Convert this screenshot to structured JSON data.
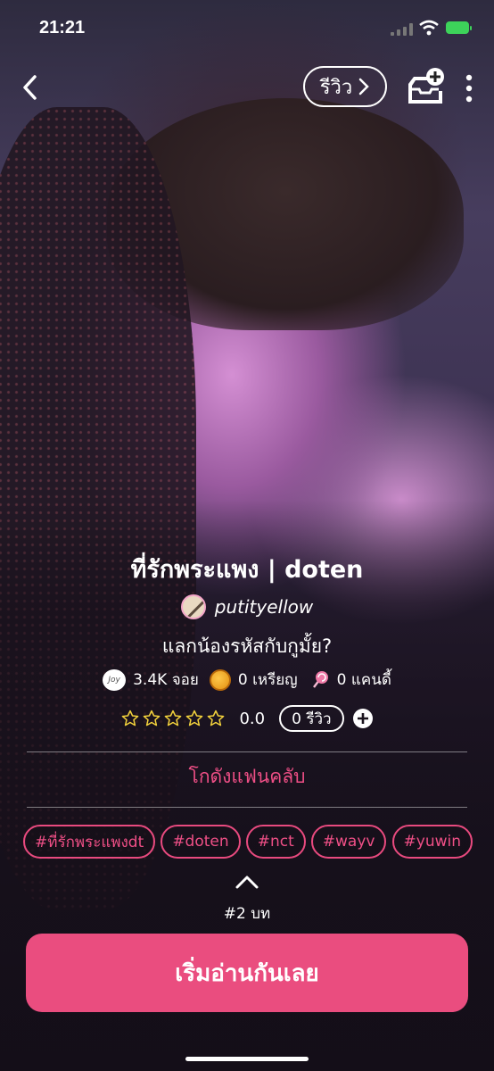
{
  "status_bar": {
    "time": "21:21"
  },
  "header": {
    "review_label": "รีวิว"
  },
  "story": {
    "title": "ที่รักพระแพง | doten",
    "author": "putityellow",
    "tagline": "แลกน้องรหัสกับกูมั้ย?"
  },
  "stats": {
    "joy_badge": "Joy",
    "joy": "3.4K จอย",
    "coins": "0 เหรียญ",
    "candy": "0 แคนดี้"
  },
  "rating": {
    "stars_filled": 0,
    "stars_total": 5,
    "value": "0.0",
    "review_count": "0 รีวิว"
  },
  "fanclub_label": "โกดังแฟนคลับ",
  "tags": [
    "#ที่รักพระแพงdt",
    "#doten",
    "#nct",
    "#wayv",
    "#yuwin"
  ],
  "chapter_label": "#2 บท",
  "start_button": "เริ่มอ่านกันเลย",
  "colors": {
    "accent": "#ea4d7f",
    "tag": "#ef4f86",
    "battery": "#3dd35a"
  }
}
